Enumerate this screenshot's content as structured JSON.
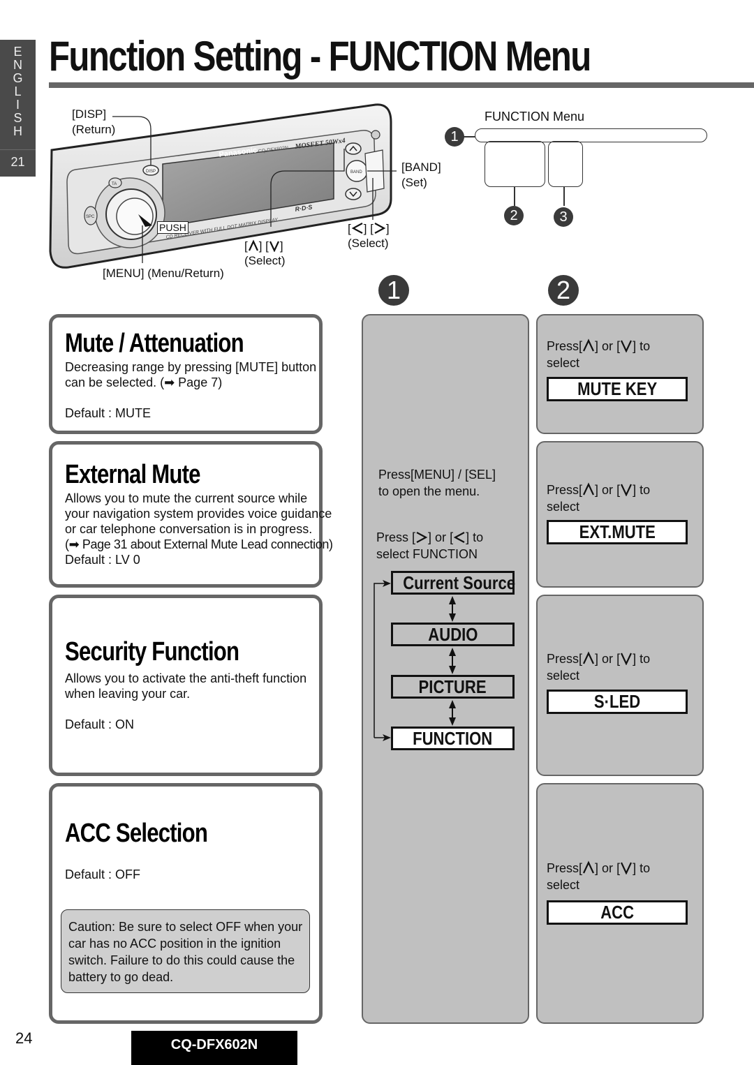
{
  "side_tab": {
    "language_letters": [
      "E",
      "N",
      "G",
      "L",
      "I",
      "S",
      "H"
    ],
    "section_number": "21"
  },
  "page_title": "Function Setting - FUNCTION Menu",
  "device": {
    "brand": "Panasonic",
    "model_small": "CQ-DFX602N",
    "power_label": "MOSFET 50Wx4",
    "bottom_label": "CD RECEIVER WITH FULL DOT MATRIX DISPLAY",
    "rds_label": "R·D·S",
    "button_disp": "DISP",
    "button_ta": "TA",
    "button_spc": "SPC",
    "button_band": "BAND",
    "callouts": {
      "disp": "[DISP]",
      "disp_sub": "(Return)",
      "push": "PUSH",
      "menu": "[MENU]  (Menu/Return)",
      "updown_sub": "(Select)",
      "band": "[BAND]",
      "band_sub": "(Set)",
      "leftright_sub": "(Select)"
    }
  },
  "function_menu_diagram": {
    "title": "FUNCTION Menu",
    "markers": [
      "1",
      "2",
      "3"
    ]
  },
  "step_markers": [
    "1",
    "2"
  ],
  "settings": [
    {
      "title": "Mute / Attenuation",
      "lines": [
        "Decreasing range by pressing [MUTE] button",
        "can be selected. (➡ Page 7)"
      ],
      "default": "Default : MUTE",
      "option": "MUTE KEY"
    },
    {
      "title": "External Mute",
      "lines": [
        "Allows you to mute the current source while",
        "your navigation system provides voice guidance",
        "or car telephone conversation is in progress.",
        "(➡ Page 31 about External Mute Lead connection)"
      ],
      "default": "Default : LV  0",
      "option": "EXT.MUTE"
    },
    {
      "title": "Security Function",
      "lines": [
        "Allows you to activate the anti-theft function",
        "when leaving your car."
      ],
      "default": "Default : ON",
      "option": "S·LED"
    },
    {
      "title": "ACC Selection",
      "lines": [],
      "default": "Default : OFF",
      "caution": [
        "Caution:  Be sure to select OFF when your",
        "car has no ACC position in the ignition",
        "switch. Failure to do this could cause the",
        "battery to go dead."
      ],
      "option": "ACC"
    }
  ],
  "middle": {
    "open_line1": "Press[MENU] / [SEL]",
    "open_line2": "to open the menu.",
    "select_prefix": "Press",
    "select_mid": "or",
    "select_suffix": "to",
    "select_line2": "select FUNCTION",
    "flow": [
      "Current Source",
      "AUDIO",
      "PICTURE",
      "FUNCTION"
    ],
    "active_flow": "FUNCTION"
  },
  "right": {
    "press": "Press",
    "or": "or",
    "to": "to",
    "select": "select"
  },
  "footer": {
    "page_number": "24",
    "model": "CQ-DFX602N"
  }
}
